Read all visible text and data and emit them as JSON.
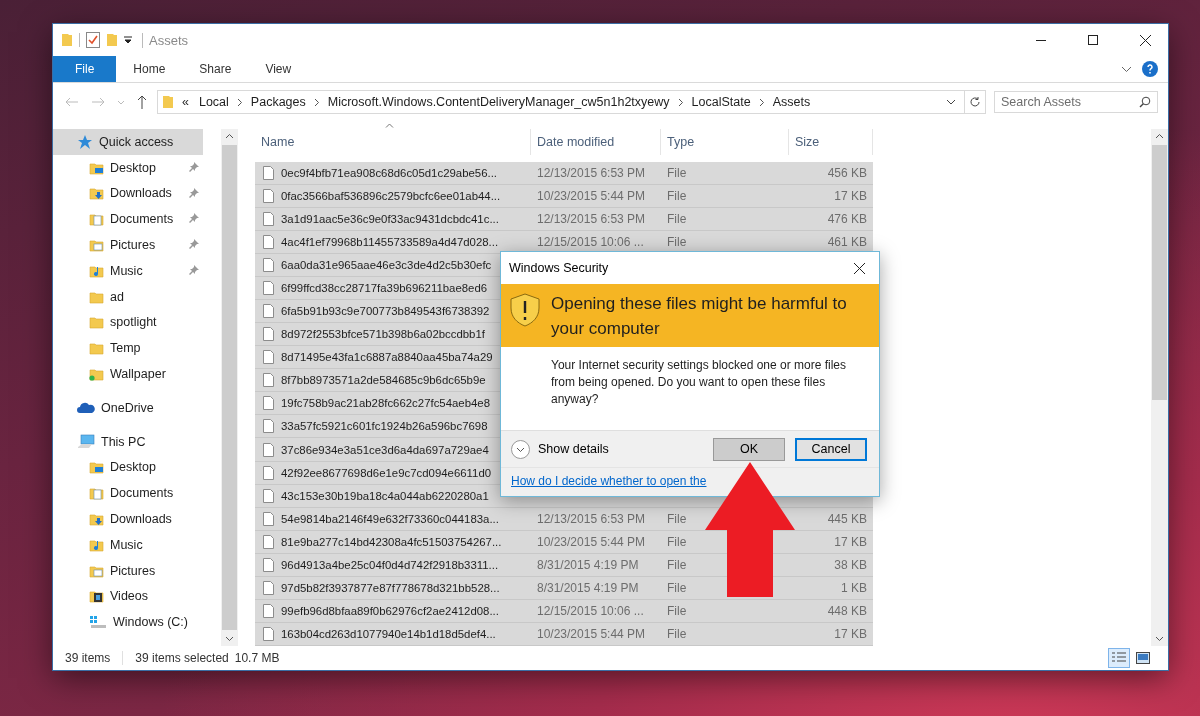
{
  "window": {
    "title": "Assets"
  },
  "ribbon": {
    "tabs": [
      {
        "label": "File",
        "kind": "file"
      },
      {
        "label": "Home",
        "kind": "tab"
      },
      {
        "label": "Share",
        "kind": "tab"
      },
      {
        "label": "View",
        "kind": "tab"
      }
    ]
  },
  "address_bar": {
    "overflow": "«",
    "path": [
      "Local",
      "Packages",
      "Microsoft.Windows.ContentDeliveryManager_cw5n1h2txyewy",
      "LocalState",
      "Assets"
    ]
  },
  "search": {
    "placeholder": "Search Assets"
  },
  "navigation": {
    "items": [
      {
        "label": "Quick access",
        "kind": "star",
        "selected": true,
        "children": [
          {
            "label": "Desktop",
            "kind": "desktop",
            "pinned": true,
            "selected": false
          },
          {
            "label": "Downloads",
            "kind": "downloads",
            "pinned": true,
            "selected": false
          },
          {
            "label": "Documents",
            "kind": "documents",
            "pinned": true,
            "selected": false
          },
          {
            "label": "Pictures",
            "kind": "pictures",
            "pinned": true,
            "selected": false
          },
          {
            "label": "Music",
            "kind": "music",
            "pinned": true,
            "selected": false
          },
          {
            "label": "ad",
            "kind": "folder",
            "pinned": false,
            "selected": false
          },
          {
            "label": "spotlight",
            "kind": "folder",
            "pinned": false,
            "selected": false
          },
          {
            "label": "Temp",
            "kind": "folder",
            "pinned": false,
            "selected": false
          },
          {
            "label": "Wallpaper",
            "kind": "synced",
            "pinned": false,
            "selected": false
          }
        ]
      },
      {
        "label": "OneDrive",
        "kind": "cloud",
        "selected": false
      },
      {
        "label": "This PC",
        "kind": "pc",
        "selected": false,
        "children": [
          {
            "label": "Desktop",
            "kind": "desktop",
            "selected": false
          },
          {
            "label": "Documents",
            "kind": "documents",
            "selected": false
          },
          {
            "label": "Downloads",
            "kind": "downloads",
            "selected": false
          },
          {
            "label": "Music",
            "kind": "music",
            "selected": false
          },
          {
            "label": "Pictures",
            "kind": "pictures",
            "selected": false
          },
          {
            "label": "Videos",
            "kind": "videos",
            "selected": false
          },
          {
            "label": "Windows (C:)",
            "kind": "drive",
            "selected": false
          }
        ]
      }
    ]
  },
  "table": {
    "columns": [
      {
        "label": "Name",
        "sorted": true
      },
      {
        "label": "Date modified",
        "sorted": false
      },
      {
        "label": "Type",
        "sorted": false
      },
      {
        "label": "Size",
        "sorted": false
      }
    ],
    "rows": [
      {
        "name": "0ec9f4bfb71ea908c68d6c05d1c29abe56...",
        "date_modified": "12/13/2015 6:53 PM",
        "type": "File",
        "size": "456 KB",
        "selected": true
      },
      {
        "name": "0fac3566baf536896c2579bcfc6ee01ab44...",
        "date_modified": "10/23/2015 5:44 PM",
        "type": "File",
        "size": "17 KB",
        "selected": true
      },
      {
        "name": "3a1d91aac5e36c9e0f33ac9431dcbdc41c...",
        "date_modified": "12/13/2015 6:53 PM",
        "type": "File",
        "size": "476 KB",
        "selected": true
      },
      {
        "name": "4ac4f1ef79968b11455733589a4d47d028...",
        "date_modified": "12/15/2015 10:06 ...",
        "type": "File",
        "size": "461 KB",
        "selected": true
      },
      {
        "name": "6aa0da31e965aae46e3c3de4d2c5b30efc",
        "selected": true
      },
      {
        "name": "6f99ffcd38cc28717fa39b696211bae8ed6",
        "selected": true
      },
      {
        "name": "6fa5b91b93c9e700773b849543f6738392",
        "selected": true
      },
      {
        "name": "8d972f2553bfce571b398b6a02bccdbb1f",
        "selected": true
      },
      {
        "name": "8d71495e43fa1c6887a8840aa45ba74a29",
        "selected": true
      },
      {
        "name": "8f7bb8973571a2de584685c9b6dc65b9e",
        "selected": true
      },
      {
        "name": "19fc758b9ac21ab28fc662c27fc54aeb4e8",
        "selected": true
      },
      {
        "name": "33a57fc5921c601fc1924b26a596bc7698",
        "selected": true
      },
      {
        "name": "37c86e934e3a51ce3d6a4da697a729ae4",
        "selected": true
      },
      {
        "name": "42f92ee8677698d6e1e9c7cd094e6611d0",
        "selected": true
      },
      {
        "name": "43c153e30b19ba18c4a044ab6220280a1",
        "selected": true
      },
      {
        "name": "54e9814ba2146f49e632f73360c044183a...",
        "date_modified": "12/13/2015 6:53 PM",
        "type": "File",
        "size": "445 KB",
        "selected": true
      },
      {
        "name": "81e9ba277c14bd42308a4fc51503754267...",
        "date_modified": "10/23/2015 5:44 PM",
        "type": "File",
        "size": "17 KB",
        "selected": true
      },
      {
        "name": "96d4913a4be25c04f0d4d742f2918b3311...",
        "date_modified": "8/31/2015 4:19 PM",
        "type": "File",
        "size": "38 KB",
        "selected": true
      },
      {
        "name": "97d5b82f3937877e87f778678d321bb528...",
        "date_modified": "8/31/2015 4:19 PM",
        "type": "File",
        "size": "1 KB",
        "selected": true
      },
      {
        "name": "99efb96d8bfaa89f0b62976cf2ae2412d08...",
        "date_modified": "12/15/2015 10:06 ...",
        "type": "File",
        "size": "448 KB",
        "selected": true
      },
      {
        "name": "163b04cd263d1077940e14b1d18d5def4...",
        "date_modified": "10/23/2015 5:44 PM",
        "type": "File",
        "size": "17 KB",
        "selected": true
      }
    ]
  },
  "status_bar": {
    "item_count": "39 items",
    "selection": "39 items selected",
    "selection_size": "10.7 MB",
    "views": [
      {
        "kind": "details",
        "selected": true
      },
      {
        "kind": "large_icons",
        "selected": false
      }
    ]
  },
  "dialog": {
    "title": "Windows Security",
    "heading": "Opening these files might be harmful to your computer",
    "message": "Your Internet security settings blocked one or more files from being opened. Do you want to open these files anyway?",
    "details_toggle": {
      "label": "Show details",
      "expanded": false
    },
    "buttons": [
      {
        "label": "OK",
        "default": false
      },
      {
        "label": "Cancel",
        "default": true
      }
    ],
    "link": "How do I decide whether to open the"
  }
}
